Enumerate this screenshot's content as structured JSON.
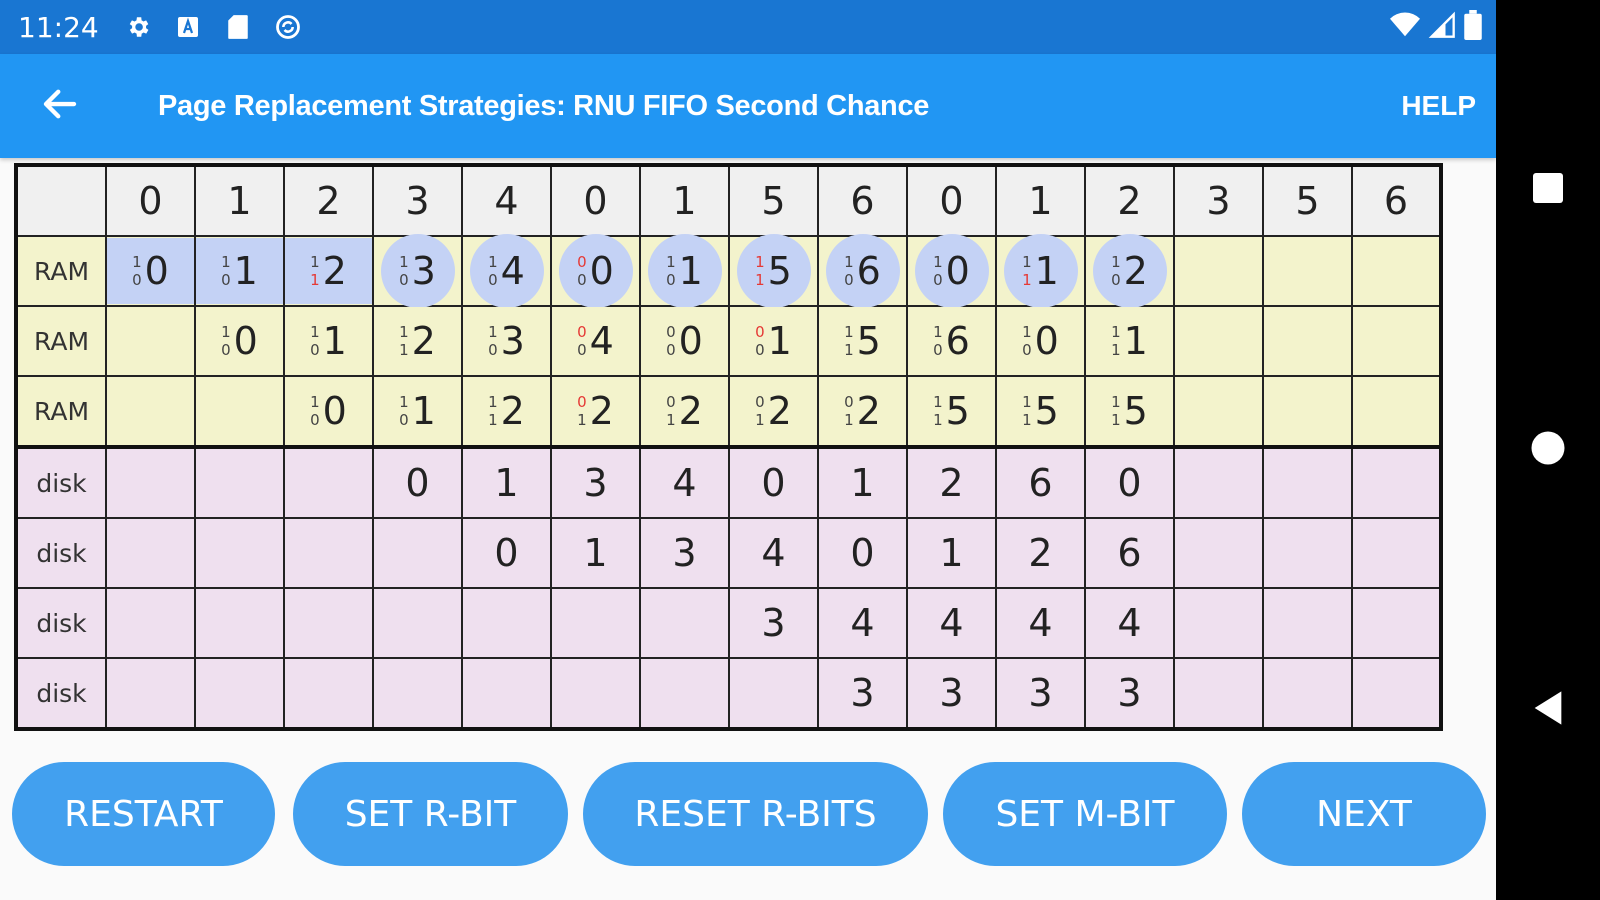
{
  "status_bar": {
    "time": "11:24",
    "icons": [
      "settings-gear-icon",
      "a-box-icon",
      "sd-card-icon",
      "sync-icon",
      "wifi-icon",
      "signal-icon",
      "battery-icon"
    ]
  },
  "app_bar": {
    "title": "Page Replacement Strategies: RNU FIFO Second Chance",
    "help": "HELP"
  },
  "table": {
    "sequence": [
      "0",
      "1",
      "2",
      "3",
      "4",
      "0",
      "1",
      "5",
      "6",
      "0",
      "1",
      "2",
      "3",
      "5",
      "6"
    ],
    "ram_rows": [
      {
        "label": "RAM",
        "cells": [
          {
            "r": "1",
            "m": "0",
            "r_red": false,
            "m_red": false,
            "page": "0",
            "style": "hl"
          },
          {
            "r": "1",
            "m": "0",
            "r_red": false,
            "m_red": false,
            "page": "1",
            "style": "hl"
          },
          {
            "r": "1",
            "m": "1",
            "r_red": false,
            "m_red": true,
            "page": "2",
            "style": "hl"
          },
          {
            "r": "1",
            "m": "0",
            "r_red": false,
            "m_red": false,
            "page": "3",
            "style": "circle"
          },
          {
            "r": "1",
            "m": "0",
            "r_red": false,
            "m_red": false,
            "page": "4",
            "style": "circle"
          },
          {
            "r": "0",
            "m": "0",
            "r_red": true,
            "m_red": false,
            "page": "0",
            "style": "circle"
          },
          {
            "r": "1",
            "m": "0",
            "r_red": false,
            "m_red": false,
            "page": "1",
            "style": "circle"
          },
          {
            "r": "1",
            "m": "1",
            "r_red": true,
            "m_red": true,
            "page": "5",
            "style": "circle"
          },
          {
            "r": "1",
            "m": "0",
            "r_red": false,
            "m_red": false,
            "page": "6",
            "style": "circle"
          },
          {
            "r": "1",
            "m": "0",
            "r_red": false,
            "m_red": false,
            "page": "0",
            "style": "circle"
          },
          {
            "r": "1",
            "m": "1",
            "r_red": false,
            "m_red": true,
            "page": "1",
            "style": "circle"
          },
          {
            "r": "1",
            "m": "0",
            "r_red": false,
            "m_red": false,
            "page": "2",
            "style": "circle"
          },
          null,
          null,
          null
        ]
      },
      {
        "label": "RAM",
        "cells": [
          null,
          {
            "r": "1",
            "m": "0",
            "r_red": false,
            "m_red": false,
            "page": "0",
            "style": ""
          },
          {
            "r": "1",
            "m": "0",
            "r_red": false,
            "m_red": false,
            "page": "1",
            "style": ""
          },
          {
            "r": "1",
            "m": "1",
            "r_red": false,
            "m_red": false,
            "page": "2",
            "style": ""
          },
          {
            "r": "1",
            "m": "0",
            "r_red": false,
            "m_red": false,
            "page": "3",
            "style": ""
          },
          {
            "r": "0",
            "m": "0",
            "r_red": true,
            "m_red": false,
            "page": "4",
            "style": ""
          },
          {
            "r": "0",
            "m": "0",
            "r_red": false,
            "m_red": false,
            "page": "0",
            "style": ""
          },
          {
            "r": "0",
            "m": "0",
            "r_red": true,
            "m_red": false,
            "page": "1",
            "style": ""
          },
          {
            "r": "1",
            "m": "1",
            "r_red": false,
            "m_red": false,
            "page": "5",
            "style": ""
          },
          {
            "r": "1",
            "m": "0",
            "r_red": false,
            "m_red": false,
            "page": "6",
            "style": ""
          },
          {
            "r": "1",
            "m": "0",
            "r_red": false,
            "m_red": false,
            "page": "0",
            "style": ""
          },
          {
            "r": "1",
            "m": "1",
            "r_red": false,
            "m_red": false,
            "page": "1",
            "style": ""
          },
          null,
          null,
          null
        ]
      },
      {
        "label": "RAM",
        "cells": [
          null,
          null,
          {
            "r": "1",
            "m": "0",
            "r_red": false,
            "m_red": false,
            "page": "0",
            "style": ""
          },
          {
            "r": "1",
            "m": "0",
            "r_red": false,
            "m_red": false,
            "page": "1",
            "style": ""
          },
          {
            "r": "1",
            "m": "1",
            "r_red": false,
            "m_red": false,
            "page": "2",
            "style": ""
          },
          {
            "r": "0",
            "m": "1",
            "r_red": true,
            "m_red": false,
            "page": "2",
            "style": ""
          },
          {
            "r": "0",
            "m": "1",
            "r_red": false,
            "m_red": false,
            "page": "2",
            "style": ""
          },
          {
            "r": "0",
            "m": "1",
            "r_red": false,
            "m_red": false,
            "page": "2",
            "style": ""
          },
          {
            "r": "0",
            "m": "1",
            "r_red": false,
            "m_red": false,
            "page": "2",
            "style": ""
          },
          {
            "r": "1",
            "m": "1",
            "r_red": false,
            "m_red": false,
            "page": "5",
            "style": ""
          },
          {
            "r": "1",
            "m": "1",
            "r_red": false,
            "m_red": false,
            "page": "5",
            "style": ""
          },
          {
            "r": "1",
            "m": "1",
            "r_red": false,
            "m_red": false,
            "page": "5",
            "style": ""
          },
          null,
          null,
          null
        ]
      }
    ],
    "disk_rows": [
      {
        "label": "disk",
        "cells": [
          "",
          "",
          "",
          "0",
          "1",
          "3",
          "4",
          "0",
          "1",
          "2",
          "6",
          "0",
          "",
          "",
          ""
        ]
      },
      {
        "label": "disk",
        "cells": [
          "",
          "",
          "",
          "",
          "0",
          "1",
          "3",
          "4",
          "0",
          "1",
          "2",
          "6",
          "",
          "",
          ""
        ]
      },
      {
        "label": "disk",
        "cells": [
          "",
          "",
          "",
          "",
          "",
          "",
          "",
          "3",
          "4",
          "4",
          "4",
          "4",
          "",
          "",
          ""
        ]
      },
      {
        "label": "disk",
        "cells": [
          "",
          "",
          "",
          "",
          "",
          "",
          "",
          "",
          "3",
          "3",
          "3",
          "3",
          "",
          "",
          ""
        ]
      }
    ]
  },
  "buttons": {
    "restart": "RESTART",
    "set_r_bit": "SET R-BIT",
    "reset_r_bits": "RESET R-BITS",
    "set_m_bit": "SET M-BIT",
    "next": "NEXT"
  },
  "nav_bar": {
    "icons": [
      "recents-square-icon",
      "home-circle-icon",
      "back-triangle-icon"
    ]
  },
  "colors": {
    "status_bar": "#1976d2",
    "app_bar": "#2196f3",
    "button": "#42a0ef",
    "ram_bg": "#f3f3cc",
    "disk_bg": "#efe0ef",
    "highlight": "#c4d2f5",
    "bit_red": "#e53935"
  }
}
